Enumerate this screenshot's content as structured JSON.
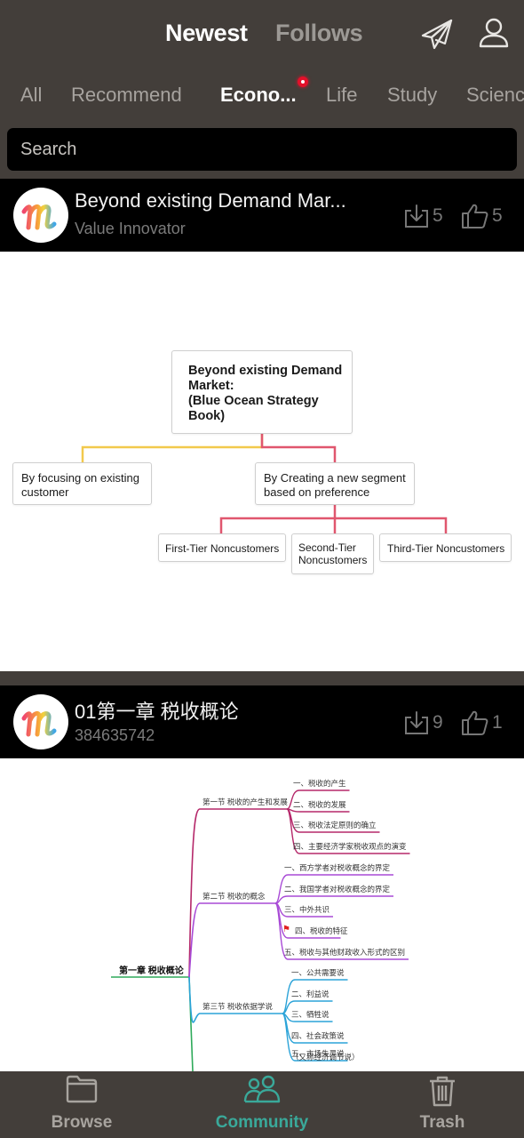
{
  "header": {
    "tabs": [
      {
        "label": "Newest",
        "active": true
      },
      {
        "label": "Follows",
        "active": false
      }
    ],
    "icons": [
      "send-icon",
      "user-icon"
    ]
  },
  "categories": {
    "items": [
      {
        "label": "All",
        "active": false
      },
      {
        "label": "Recommend",
        "active": false
      },
      {
        "label": "Econo...",
        "active": true,
        "badge": "red-dot"
      },
      {
        "label": "Life",
        "active": false
      },
      {
        "label": "Study",
        "active": false
      },
      {
        "label": "Science",
        "active": false
      }
    ]
  },
  "search": {
    "placeholder": "Search",
    "value": ""
  },
  "feed": [
    {
      "title": "Beyond existing Demand Mar...",
      "author": "Value Innovator",
      "downloads": "5",
      "likes": "5",
      "avatar": "m-logo",
      "preview": {
        "root": "Beyond existing Demand Market:\n(Blue Ocean Strategy Book)",
        "root_lines": [
          "Beyond existing Demand",
          "Market:",
          "(Blue Ocean Strategy",
          "Book)"
        ],
        "branches": [
          {
            "label_lines": [
              "By focusing on existing",
              "customer"
            ],
            "color": "#f2c94c",
            "children": []
          },
          {
            "label_lines": [
              "By Creating a new segment",
              "based on preference"
            ],
            "color": "#e0566e",
            "children": [
              {
                "label_lines": [
                  "First-Tier Noncustomers"
                ]
              },
              {
                "label_lines": [
                  "Second-Tier",
                  "Noncustomers"
                ]
              },
              {
                "label_lines": [
                  "Third-Tier Noncustomers"
                ]
              }
            ]
          }
        ]
      }
    },
    {
      "title": "01第一章 税收概论",
      "author": "384635742",
      "downloads": "9",
      "likes": "1",
      "avatar": "m-logo",
      "preview": {
        "root": "第一章 税收概论",
        "sections": [
          {
            "label": "第一节 税收的产生和发展",
            "color": "#b5286a",
            "items": [
              "一、税收的产生",
              "二、税收的发展",
              "三、税收法定原则的确立",
              "四、主要经济学家税收观点的演变"
            ]
          },
          {
            "label": "第二节 税收的概念",
            "color": "#a84ad6",
            "items": [
              "一、西方学者对税收概念的界定",
              "二、我国学者对税收概念的界定",
              "三、中外共识",
              "四、税收的特征",
              "五、税收与其他财政收入形式的区别"
            ],
            "flag_item": 3
          },
          {
            "label": "第三节 税收依据学说",
            "color": "#2ba3d8",
            "items": [
              "一、公共需要说",
              "二、利益说",
              "三、牺牲说",
              "四、社会政策说",
              "五、市场失灵说",
              "（又称经济调节说）"
            ]
          }
        ],
        "root_color": "#2eaa5a"
      }
    }
  ],
  "bottom_nav": {
    "items": [
      {
        "label": "Browse",
        "icon": "folder-icon",
        "active": false
      },
      {
        "label": "Community",
        "icon": "community-icon",
        "active": true
      },
      {
        "label": "Trash",
        "icon": "trash-icon",
        "active": false
      }
    ]
  },
  "colors": {
    "background": "#433e3a",
    "accent": "#3aa99a",
    "badge": "#e4102a"
  }
}
